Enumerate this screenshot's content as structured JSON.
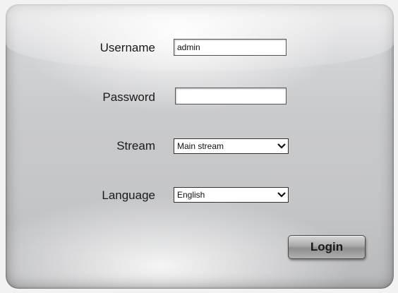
{
  "login_form": {
    "username": {
      "label": "Username",
      "value": "admin"
    },
    "password": {
      "label": "Password",
      "value": ""
    },
    "stream": {
      "label": "Stream",
      "selected": "Main stream",
      "icon": "chevron-down-icon"
    },
    "language": {
      "label": "Language",
      "selected": "English",
      "icon": "chevron-down-icon"
    },
    "login_button": {
      "label": "Login"
    }
  },
  "colors": {
    "panel_top": "#d9dadc",
    "panel_bottom": "#b8b9bb",
    "button": "#a9a9a9",
    "text": "#1a1a1a"
  }
}
